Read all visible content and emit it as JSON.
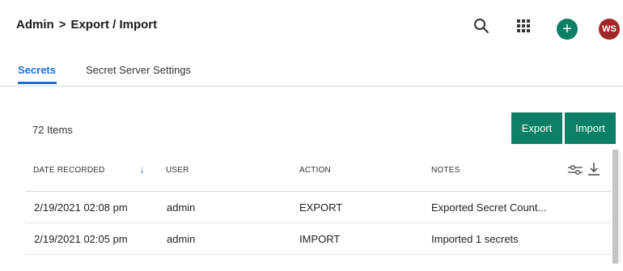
{
  "header": {
    "breadcrumb": {
      "root": "Admin",
      "separator": ">",
      "current": "Export / Import"
    },
    "icons": {
      "search": "search-icon",
      "apps": "grid-apps-icon",
      "add": "plus-icon"
    },
    "add_symbol": "+",
    "user_initials": "WS"
  },
  "tabs": [
    {
      "label": "Secrets",
      "active": true
    },
    {
      "label": "Secret Server Settings",
      "active": false
    }
  ],
  "toolbar": {
    "item_count": "72 Items",
    "export_label": "Export",
    "import_label": "Import"
  },
  "table": {
    "columns": [
      "DATE RECORDED",
      "USER",
      "ACTION",
      "NOTES"
    ],
    "sort_indicator": "↓",
    "rows": [
      {
        "date": "2/19/2021 02:08 pm",
        "user": "admin",
        "action": "EXPORT",
        "notes": "Exported Secret Count..."
      },
      {
        "date": "2/19/2021 02:05 pm",
        "user": "admin",
        "action": "IMPORT",
        "notes": "Imported 1 secrets"
      }
    ]
  },
  "colors": {
    "brand_green": "#0d7f66",
    "tab_blue": "#1f6fd1",
    "sort_blue": "#3a86d8",
    "avatar_red": "#a1262a"
  }
}
